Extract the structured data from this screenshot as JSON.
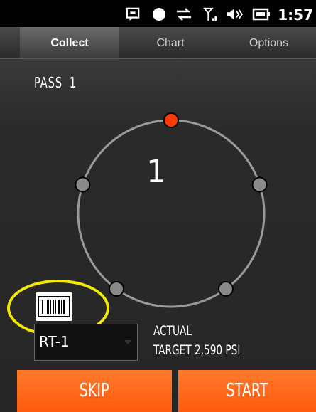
{
  "status_bar": {
    "time": "1:57",
    "icons": [
      "message-icon",
      "record-icon",
      "sync-icon",
      "signal-icon",
      "volume-icon",
      "battery-icon"
    ]
  },
  "tabs": [
    {
      "label": "Collect",
      "active": true
    },
    {
      "label": "Chart",
      "active": false
    },
    {
      "label": "Options",
      "active": false
    }
  ],
  "pass": {
    "label": "PASS",
    "number": "1"
  },
  "dial": {
    "current": "1",
    "points": 5,
    "active_point": 1,
    "active_color": "#ff3a00",
    "inactive_color": "#8a8a8a"
  },
  "barcode": {
    "icon": "barcode-icon"
  },
  "tool_select": {
    "value": "RT-1"
  },
  "readout": {
    "actual_label": "ACTUAL",
    "target_line": "TARGET  2,590 PSI"
  },
  "buttons": {
    "skip": "SKIP",
    "start": "START"
  },
  "colors": {
    "accent": "#ff5a0e",
    "highlight": "#f3ea00"
  }
}
